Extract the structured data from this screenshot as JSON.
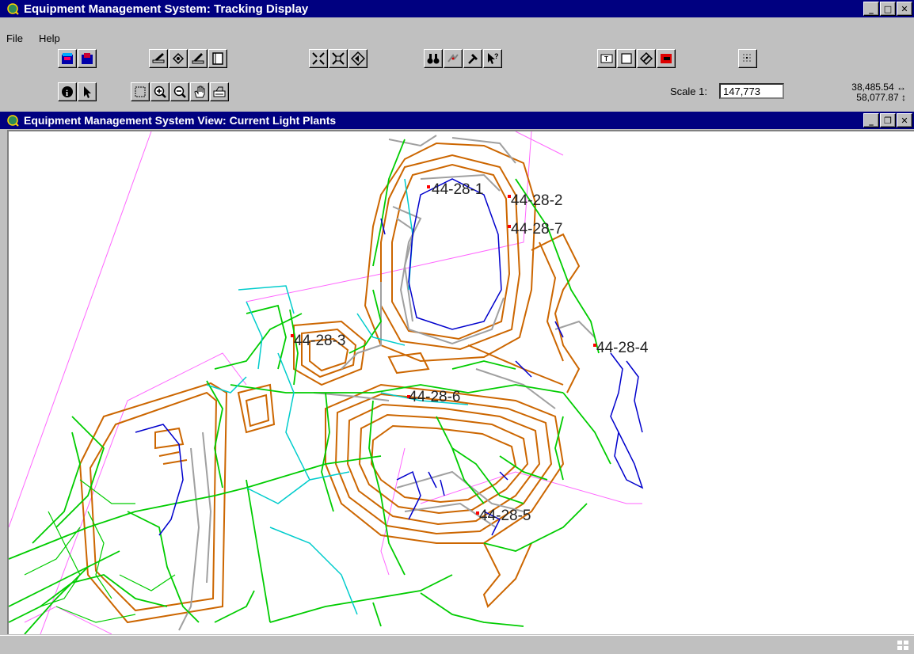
{
  "main_window": {
    "title": "Equipment Management System: Tracking Display"
  },
  "menu": {
    "items": [
      "File",
      "Help"
    ]
  },
  "scale": {
    "label": "Scale 1:",
    "value": "147,773"
  },
  "coordinates": {
    "x": "38,485.54",
    "y": "58,077.87"
  },
  "view_window": {
    "title": "Equipment Management System View: Current Light Plants"
  },
  "map": {
    "light_plants": [
      {
        "id": "44-28-1",
        "label": "44-28-1"
      },
      {
        "id": "44-28-2",
        "label": "44-28-2"
      },
      {
        "id": "44-28-7",
        "label": "44-28-7"
      },
      {
        "id": "44-28-3",
        "label": "44-28-3"
      },
      {
        "id": "44-28-4",
        "label": "44-28-4"
      },
      {
        "id": "44-28-6",
        "label": "44-28-6"
      },
      {
        "id": "44-28-5",
        "label": "44-28-5"
      }
    ],
    "colors": {
      "roads": "#00cc00",
      "benches": "#cc6600",
      "water": "#0000cc",
      "spoil": "#a0a0a0",
      "haul": "#00cccc",
      "boundary": "#ff66ff",
      "marker": "#ff0000"
    }
  },
  "icons": {
    "toolbar1": [
      "layer-blue-icon",
      "layer-red-icon",
      "edit-layer-icon",
      "add-layer-icon",
      "modify-layer-icon",
      "blank-layer-icon",
      "zoom-extent-icon",
      "zoom-in-extent-icon",
      "back-icon",
      "find-icon",
      "track-icon",
      "hammer-icon",
      "query-icon",
      "text-icon",
      "box-icon",
      "symbol-icon",
      "magnet-icon",
      "grid-icon"
    ],
    "toolbar2": [
      "info-icon",
      "pointer-icon",
      "select-box-icon",
      "zoom-in-icon",
      "zoom-out-icon",
      "pan-hand-icon",
      "print-icon"
    ]
  }
}
